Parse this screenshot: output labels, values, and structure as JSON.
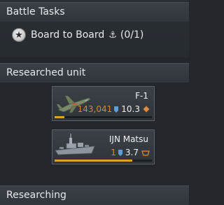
{
  "battle_tasks": {
    "title": "Battle Tasks",
    "task": {
      "icon": "medal-star-icon",
      "label": "Board to Board",
      "anchor_icon": "anchor-icon",
      "anchor_glyph": "⚓",
      "progress": "(0/1)"
    }
  },
  "researched": {
    "title": "Researched unit",
    "units": [
      {
        "name": "F-1",
        "rp": "143,041",
        "br": "10.3",
        "icon": "jet-aircraft-icon",
        "class_icon": "fighter-class-icon",
        "progress_fraction": 0.1
      },
      {
        "name": "IJN Matsu",
        "rp": "1",
        "br": "3.7",
        "icon": "destroyer-ship-icon",
        "class_icon": "naval-class-icon",
        "progress_fraction": 0.8
      }
    ]
  },
  "bottom": {
    "title": "Researching"
  },
  "colors": {
    "rp": "#d08a2a",
    "rank_blue": "#5f9ed8",
    "progress": "#d9a42c",
    "diamond": "#e08a3c"
  }
}
